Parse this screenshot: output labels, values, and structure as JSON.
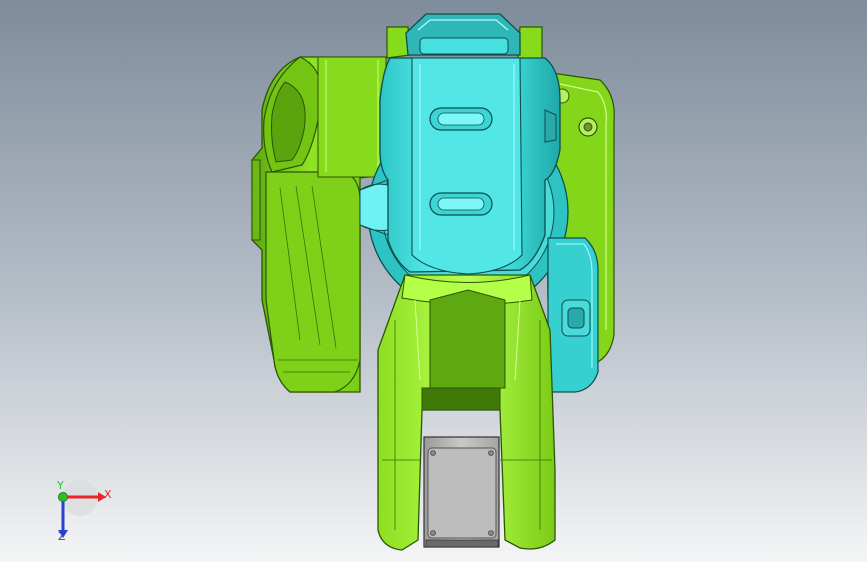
{
  "viewport": {
    "background": {
      "top": "#7e8c9b",
      "bottom": "#f4f5f6"
    }
  },
  "model": {
    "name": "robot-arm-assembly",
    "colors": {
      "green": "#88e51c",
      "green_dark": "#4c8d0b",
      "green_light": "#c2ff6a",
      "cyan": "#3fe2e2",
      "cyan_dark": "#1b9696",
      "cyan_light": "#a9ffff",
      "gray": "#b9b9b9",
      "gray_dark": "#5c5c5c"
    }
  },
  "triad": {
    "x_label": "X",
    "y_label": "Y",
    "z_label": "Z",
    "x_color": "#e8252a",
    "y_color": "#2fbf2f",
    "z_color": "#2b3fd1"
  }
}
